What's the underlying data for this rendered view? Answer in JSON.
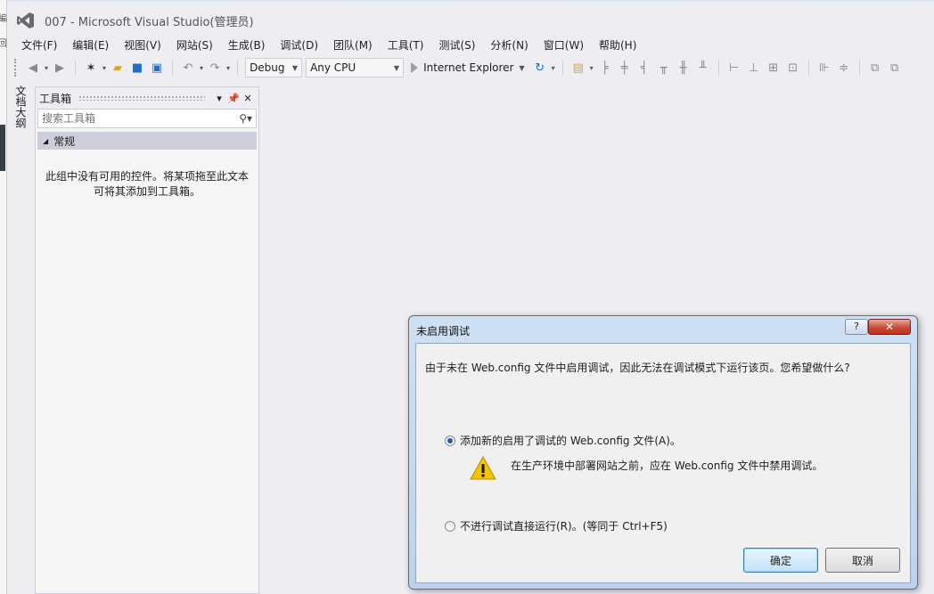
{
  "window": {
    "title": "007 - Microsoft Visual Studio(管理员)"
  },
  "left_strip": {
    "glyphs": [
      "編",
      "回"
    ]
  },
  "menu": [
    "文件(F)",
    "编辑(E)",
    "视图(V)",
    "网站(S)",
    "生成(B)",
    "调试(D)",
    "团队(M)",
    "工具(T)",
    "测试(S)",
    "分析(N)",
    "窗口(W)",
    "帮助(H)"
  ],
  "toolbar": {
    "config": "Debug",
    "platform": "Any CPU",
    "browser": "Internet Explorer"
  },
  "side_tab": {
    "label": "文档大纲"
  },
  "toolbox": {
    "title": "工具箱",
    "search_placeholder": "搜索工具箱",
    "group": "常规",
    "empty_line1": "此组中没有可用的控件。将某项拖至此文本",
    "empty_line2": "可将其添加到工具箱。"
  },
  "dialog": {
    "title": "未启用调试",
    "help_label": "?",
    "close_label": "✕",
    "message": "由于未在 Web.config 文件中启用调试，因此无法在调试模式下运行该页。您希望做什么?",
    "option1": "添加新的启用了调试的 Web.config 文件(A)。",
    "warning": "在生产环境中部署网站之前，应在 Web.config 文件中禁用调试。",
    "option2": "不进行调试直接运行(R)。(等同于 Ctrl+F5)",
    "ok": "确定",
    "cancel": "取消",
    "selected_option": 1
  },
  "colors": {
    "accent": "#68217a",
    "dialog_frame": "#bcd2ee",
    "close_red": "#c74a38"
  }
}
